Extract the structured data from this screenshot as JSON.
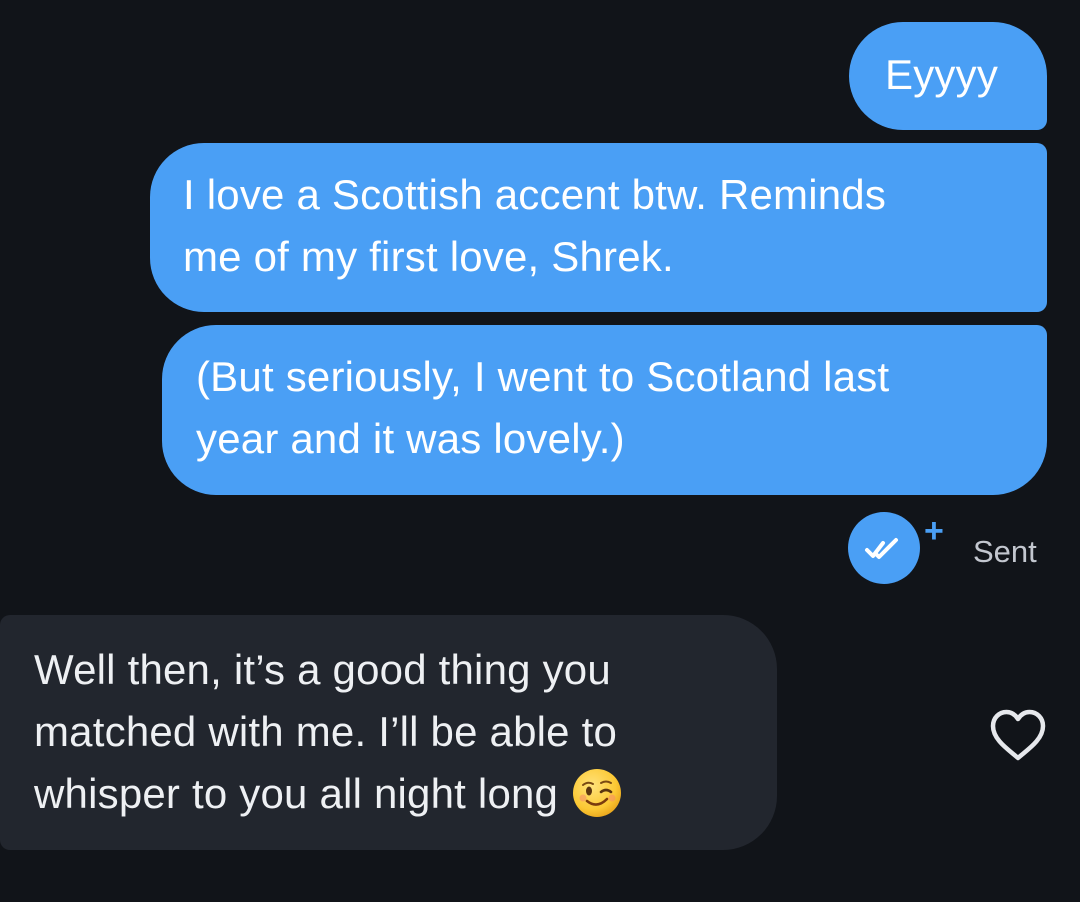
{
  "conversation": {
    "outgoing": [
      {
        "lines": [
          "Eyyyy"
        ]
      },
      {
        "lines": [
          "I love a Scottish accent btw. Reminds",
          "me of my first love, Shrek."
        ]
      },
      {
        "lines": [
          "(But seriously, I went to Scotland last",
          "year and it was lovely.)"
        ]
      }
    ],
    "status": {
      "read_icon": "double-check-icon",
      "plus_symbol": "+",
      "label": "Sent"
    },
    "incoming": [
      {
        "lines": [
          "Well then, it’s a good thing you",
          "matched with me. I’ll be able to",
          "whisper to you all night long"
        ],
        "emoji": "winking-face-emoji",
        "like_icon": "heart-outline-icon"
      }
    ]
  },
  "colors": {
    "background": "#111419",
    "outgoing_bubble": "#4a9ff5",
    "incoming_bubble": "#22262e",
    "accent": "#4a9ff5",
    "status_text": "#c3c7cf"
  }
}
